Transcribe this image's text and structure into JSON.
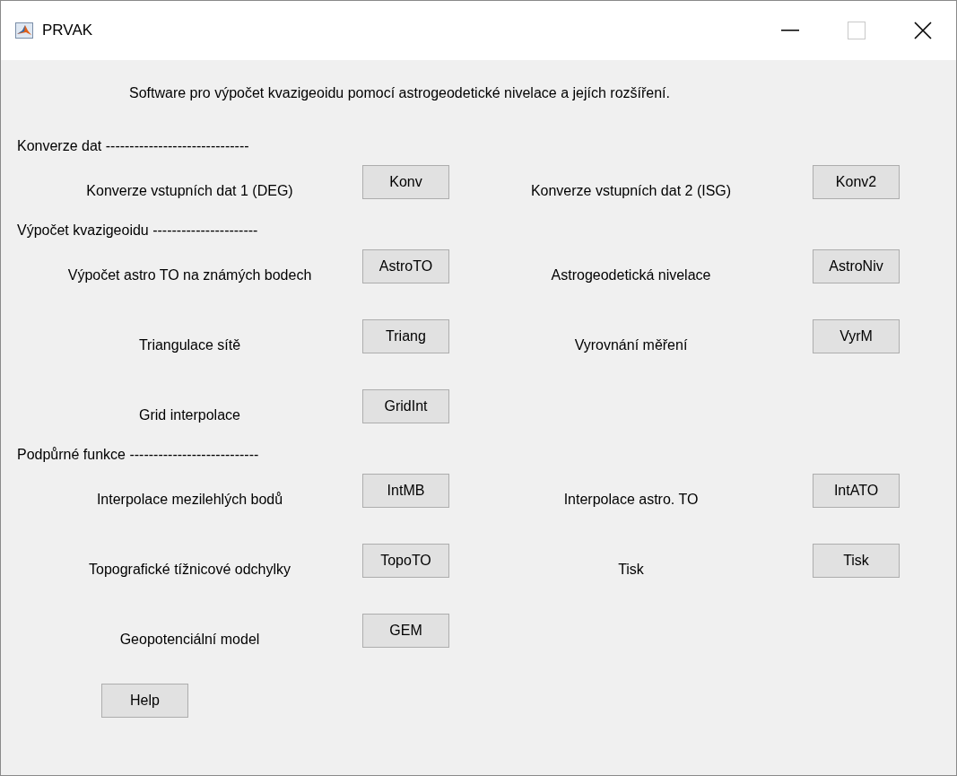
{
  "window": {
    "title": "PRVAK"
  },
  "description": "Software pro výpočet kvazigeoidu pomocí astrogeodetické nivelace a jejích rozšíření.",
  "sections": [
    {
      "heading": "Konverze dat ------------------------------",
      "rows": [
        {
          "left": {
            "label": "Konverze vstupních dat 1 (DEG)",
            "button": "Konv"
          },
          "right": {
            "label": "Konverze vstupních dat 2 (ISG)",
            "button": "Konv2"
          }
        }
      ]
    },
    {
      "heading": "Výpočet kvazigeoidu ----------------------",
      "rows": [
        {
          "left": {
            "label": "Výpočet astro TO na známých bodech",
            "button": "AstroTO"
          },
          "right": {
            "label": "Astrogeodetická nivelace",
            "button": "AstroNiv"
          }
        },
        {
          "left": {
            "label": "Triangulace sítě",
            "button": "Triang"
          },
          "right": {
            "label": "Vyrovnání měření",
            "button": "VyrM"
          }
        },
        {
          "left": {
            "label": "Grid interpolace",
            "button": "GridInt"
          }
        }
      ]
    },
    {
      "heading": "Podpůrné funkce ---------------------------",
      "rows": [
        {
          "left": {
            "label": "Interpolace mezilehlých bodů",
            "button": "IntMB"
          },
          "right": {
            "label": "Interpolace astro. TO",
            "button": "IntATO"
          }
        },
        {
          "left": {
            "label": "Topografické tížnicové odchylky",
            "button": "TopoTO"
          },
          "right": {
            "label": "Tisk",
            "button": "Tisk"
          }
        },
        {
          "left": {
            "label": "Geopotenciální model",
            "button": "GEM"
          }
        }
      ]
    }
  ],
  "help_button": "Help"
}
